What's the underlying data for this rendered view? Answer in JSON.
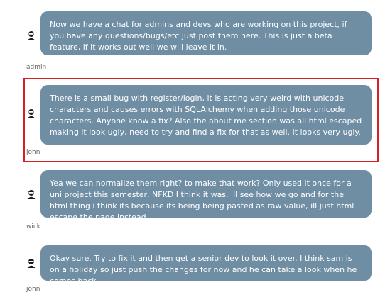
{
  "theme": {
    "bubble_color": "#6f8da3",
    "bubble_text_color": "#ffffff",
    "highlight_color": "#d81f26",
    "username_color": "#666666"
  },
  "messages": [
    {
      "author": "admin",
      "avatar_icon": "user-avatar-icon",
      "text": "Now we have a chat for admins and devs who are working on this project, if you have any questions/bugs/etc just post them here. This is just a beta feature, if it works out well we will leave it in."
    },
    {
      "author": "john",
      "avatar_icon": "user-avatar-icon",
      "highlighted": true,
      "text": "There is a small bug with register/login, it is acting very weird with unicode characters and causes errors with SQLAlchemy when adding those unicode characters. Anyone know a fix? Also the about me section was all html escaped making it look ugly, need to try and find a fix for that as well. It looks very ugly."
    },
    {
      "author": "wick",
      "avatar_icon": "user-avatar-icon",
      "text": "Yea we can normalize them right? to make that work? Only used it once for a uni project this semester, NFKD I think it was, ill see how we go and for the html thing i think its because its being being pasted as raw value, ill just html escape the page instead"
    },
    {
      "author": "john",
      "avatar_icon": "user-avatar-icon",
      "text": "Okay sure. Try to fix it and then get a senior dev to look it over. I think sam is on a holiday so just push the changes for now and he can take a look when he comes back."
    }
  ]
}
